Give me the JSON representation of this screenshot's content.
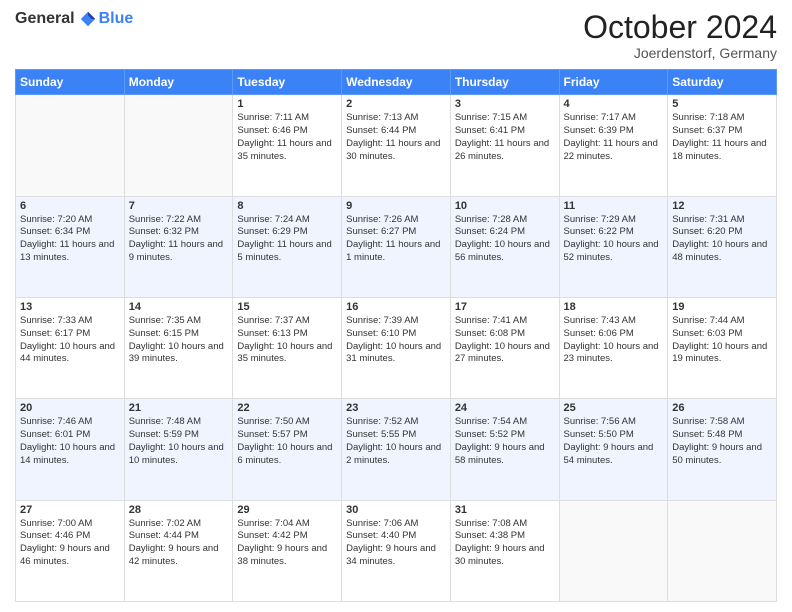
{
  "header": {
    "logo_general": "General",
    "logo_blue": "Blue",
    "month": "October 2024",
    "location": "Joerdenstorf, Germany"
  },
  "weekdays": [
    "Sunday",
    "Monday",
    "Tuesday",
    "Wednesday",
    "Thursday",
    "Friday",
    "Saturday"
  ],
  "weeks": [
    [
      {
        "day": "",
        "sunrise": "",
        "sunset": "",
        "daylight": ""
      },
      {
        "day": "",
        "sunrise": "",
        "sunset": "",
        "daylight": ""
      },
      {
        "day": "1",
        "sunrise": "Sunrise: 7:11 AM",
        "sunset": "Sunset: 6:46 PM",
        "daylight": "Daylight: 11 hours and 35 minutes."
      },
      {
        "day": "2",
        "sunrise": "Sunrise: 7:13 AM",
        "sunset": "Sunset: 6:44 PM",
        "daylight": "Daylight: 11 hours and 30 minutes."
      },
      {
        "day": "3",
        "sunrise": "Sunrise: 7:15 AM",
        "sunset": "Sunset: 6:41 PM",
        "daylight": "Daylight: 11 hours and 26 minutes."
      },
      {
        "day": "4",
        "sunrise": "Sunrise: 7:17 AM",
        "sunset": "Sunset: 6:39 PM",
        "daylight": "Daylight: 11 hours and 22 minutes."
      },
      {
        "day": "5",
        "sunrise": "Sunrise: 7:18 AM",
        "sunset": "Sunset: 6:37 PM",
        "daylight": "Daylight: 11 hours and 18 minutes."
      }
    ],
    [
      {
        "day": "6",
        "sunrise": "Sunrise: 7:20 AM",
        "sunset": "Sunset: 6:34 PM",
        "daylight": "Daylight: 11 hours and 13 minutes."
      },
      {
        "day": "7",
        "sunrise": "Sunrise: 7:22 AM",
        "sunset": "Sunset: 6:32 PM",
        "daylight": "Daylight: 11 hours and 9 minutes."
      },
      {
        "day": "8",
        "sunrise": "Sunrise: 7:24 AM",
        "sunset": "Sunset: 6:29 PM",
        "daylight": "Daylight: 11 hours and 5 minutes."
      },
      {
        "day": "9",
        "sunrise": "Sunrise: 7:26 AM",
        "sunset": "Sunset: 6:27 PM",
        "daylight": "Daylight: 11 hours and 1 minute."
      },
      {
        "day": "10",
        "sunrise": "Sunrise: 7:28 AM",
        "sunset": "Sunset: 6:24 PM",
        "daylight": "Daylight: 10 hours and 56 minutes."
      },
      {
        "day": "11",
        "sunrise": "Sunrise: 7:29 AM",
        "sunset": "Sunset: 6:22 PM",
        "daylight": "Daylight: 10 hours and 52 minutes."
      },
      {
        "day": "12",
        "sunrise": "Sunrise: 7:31 AM",
        "sunset": "Sunset: 6:20 PM",
        "daylight": "Daylight: 10 hours and 48 minutes."
      }
    ],
    [
      {
        "day": "13",
        "sunrise": "Sunrise: 7:33 AM",
        "sunset": "Sunset: 6:17 PM",
        "daylight": "Daylight: 10 hours and 44 minutes."
      },
      {
        "day": "14",
        "sunrise": "Sunrise: 7:35 AM",
        "sunset": "Sunset: 6:15 PM",
        "daylight": "Daylight: 10 hours and 39 minutes."
      },
      {
        "day": "15",
        "sunrise": "Sunrise: 7:37 AM",
        "sunset": "Sunset: 6:13 PM",
        "daylight": "Daylight: 10 hours and 35 minutes."
      },
      {
        "day": "16",
        "sunrise": "Sunrise: 7:39 AM",
        "sunset": "Sunset: 6:10 PM",
        "daylight": "Daylight: 10 hours and 31 minutes."
      },
      {
        "day": "17",
        "sunrise": "Sunrise: 7:41 AM",
        "sunset": "Sunset: 6:08 PM",
        "daylight": "Daylight: 10 hours and 27 minutes."
      },
      {
        "day": "18",
        "sunrise": "Sunrise: 7:43 AM",
        "sunset": "Sunset: 6:06 PM",
        "daylight": "Daylight: 10 hours and 23 minutes."
      },
      {
        "day": "19",
        "sunrise": "Sunrise: 7:44 AM",
        "sunset": "Sunset: 6:03 PM",
        "daylight": "Daylight: 10 hours and 19 minutes."
      }
    ],
    [
      {
        "day": "20",
        "sunrise": "Sunrise: 7:46 AM",
        "sunset": "Sunset: 6:01 PM",
        "daylight": "Daylight: 10 hours and 14 minutes."
      },
      {
        "day": "21",
        "sunrise": "Sunrise: 7:48 AM",
        "sunset": "Sunset: 5:59 PM",
        "daylight": "Daylight: 10 hours and 10 minutes."
      },
      {
        "day": "22",
        "sunrise": "Sunrise: 7:50 AM",
        "sunset": "Sunset: 5:57 PM",
        "daylight": "Daylight: 10 hours and 6 minutes."
      },
      {
        "day": "23",
        "sunrise": "Sunrise: 7:52 AM",
        "sunset": "Sunset: 5:55 PM",
        "daylight": "Daylight: 10 hours and 2 minutes."
      },
      {
        "day": "24",
        "sunrise": "Sunrise: 7:54 AM",
        "sunset": "Sunset: 5:52 PM",
        "daylight": "Daylight: 9 hours and 58 minutes."
      },
      {
        "day": "25",
        "sunrise": "Sunrise: 7:56 AM",
        "sunset": "Sunset: 5:50 PM",
        "daylight": "Daylight: 9 hours and 54 minutes."
      },
      {
        "day": "26",
        "sunrise": "Sunrise: 7:58 AM",
        "sunset": "Sunset: 5:48 PM",
        "daylight": "Daylight: 9 hours and 50 minutes."
      }
    ],
    [
      {
        "day": "27",
        "sunrise": "Sunrise: 7:00 AM",
        "sunset": "Sunset: 4:46 PM",
        "daylight": "Daylight: 9 hours and 46 minutes."
      },
      {
        "day": "28",
        "sunrise": "Sunrise: 7:02 AM",
        "sunset": "Sunset: 4:44 PM",
        "daylight": "Daylight: 9 hours and 42 minutes."
      },
      {
        "day": "29",
        "sunrise": "Sunrise: 7:04 AM",
        "sunset": "Sunset: 4:42 PM",
        "daylight": "Daylight: 9 hours and 38 minutes."
      },
      {
        "day": "30",
        "sunrise": "Sunrise: 7:06 AM",
        "sunset": "Sunset: 4:40 PM",
        "daylight": "Daylight: 9 hours and 34 minutes."
      },
      {
        "day": "31",
        "sunrise": "Sunrise: 7:08 AM",
        "sunset": "Sunset: 4:38 PM",
        "daylight": "Daylight: 9 hours and 30 minutes."
      },
      {
        "day": "",
        "sunrise": "",
        "sunset": "",
        "daylight": ""
      },
      {
        "day": "",
        "sunrise": "",
        "sunset": "",
        "daylight": ""
      }
    ]
  ]
}
